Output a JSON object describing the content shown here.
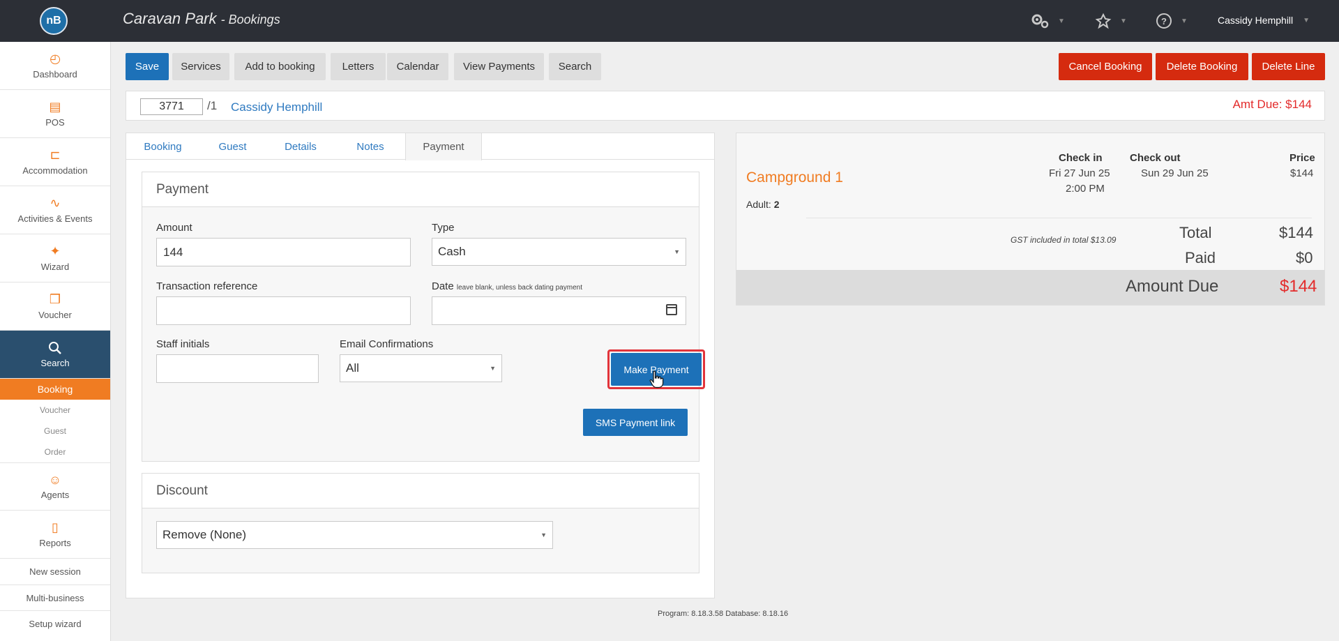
{
  "header": {
    "logo_text": "nB",
    "title": "Caravan Park",
    "subtitle": "Bookings",
    "user_name": "Cassidy Hemphill",
    "icons": [
      "settings-icon",
      "integrations-icon",
      "help-icon"
    ]
  },
  "sidebar": {
    "items": [
      {
        "label": "Dashboard",
        "icon": "dashboard-icon"
      },
      {
        "label": "POS",
        "icon": "register-icon"
      },
      {
        "label": "Accommodation",
        "icon": "bed-icon"
      },
      {
        "label": "Activities & Events",
        "icon": "activities-icon"
      },
      {
        "label": "Wizard",
        "icon": "wand-icon"
      },
      {
        "label": "Voucher",
        "icon": "gift-icon"
      },
      {
        "label": "Search",
        "icon": "search-icon"
      }
    ],
    "search_sub": [
      "Booking",
      "Voucher",
      "Guest",
      "Order"
    ],
    "more_items": [
      {
        "label": "Agents",
        "icon": "agents-icon"
      },
      {
        "label": "Reports",
        "icon": "report-icon"
      }
    ],
    "links": [
      "New session",
      "Multi-business",
      "Setup wizard"
    ]
  },
  "toolbar": {
    "save": "Save",
    "services": "Services",
    "add_to_booking": "Add to booking",
    "letters": "Letters",
    "calendar": "Calendar",
    "view_payments": "View Payments",
    "search": "Search",
    "cancel_booking": "Cancel Booking",
    "delete_booking": "Delete Booking",
    "delete_line": "Delete Line"
  },
  "booking": {
    "number": "3771",
    "suffix": "/1",
    "guest": "Cassidy Hemphill",
    "amount_due_header": "Amt Due: $144"
  },
  "tabs": [
    "Booking",
    "Guest",
    "Details",
    "Notes",
    "Payment"
  ],
  "active_tab": "Payment",
  "payment": {
    "heading": "Payment",
    "amount_label": "Amount",
    "amount_value": "144",
    "type_label": "Type",
    "type_value": "Cash",
    "txn_ref_label": "Transaction reference",
    "txn_ref_value": "",
    "date_label": "Date",
    "date_hint": "leave blank, unless back dating payment",
    "date_value": "",
    "staff_initials_label": "Staff initials",
    "staff_initials_value": "",
    "email_conf_label": "Email Confirmations",
    "email_conf_value": "All",
    "make_payment": "Make Payment",
    "sms_link": "SMS Payment link"
  },
  "discount": {
    "heading": "Discount",
    "value": "Remove (None)"
  },
  "summary": {
    "site": "Campground 1",
    "adult_label": "Adult:",
    "adult_count": "2",
    "check_in_label": "Check in",
    "check_in_date": "Fri 27 Jun 25",
    "check_in_time": "2:00 PM",
    "check_out_label": "Check out",
    "check_out_date": "Sun 29 Jun 25",
    "price_label": "Price",
    "price_value": "$144",
    "gst_note": "GST included in total $13.09",
    "total_label": "Total",
    "total_value": "$144",
    "paid_label": "Paid",
    "paid_value": "$0",
    "due_label": "Amount Due",
    "due_value": "$144"
  },
  "footer": {
    "version": "Program: 8.18.3.58 Database: 8.18.16"
  },
  "colors": {
    "topbar": "#2c2f36",
    "accent_orange": "#f07c22",
    "primary_blue": "#1d71b8",
    "danger_red": "#d52b0f",
    "link_blue": "#2f7ac0"
  }
}
